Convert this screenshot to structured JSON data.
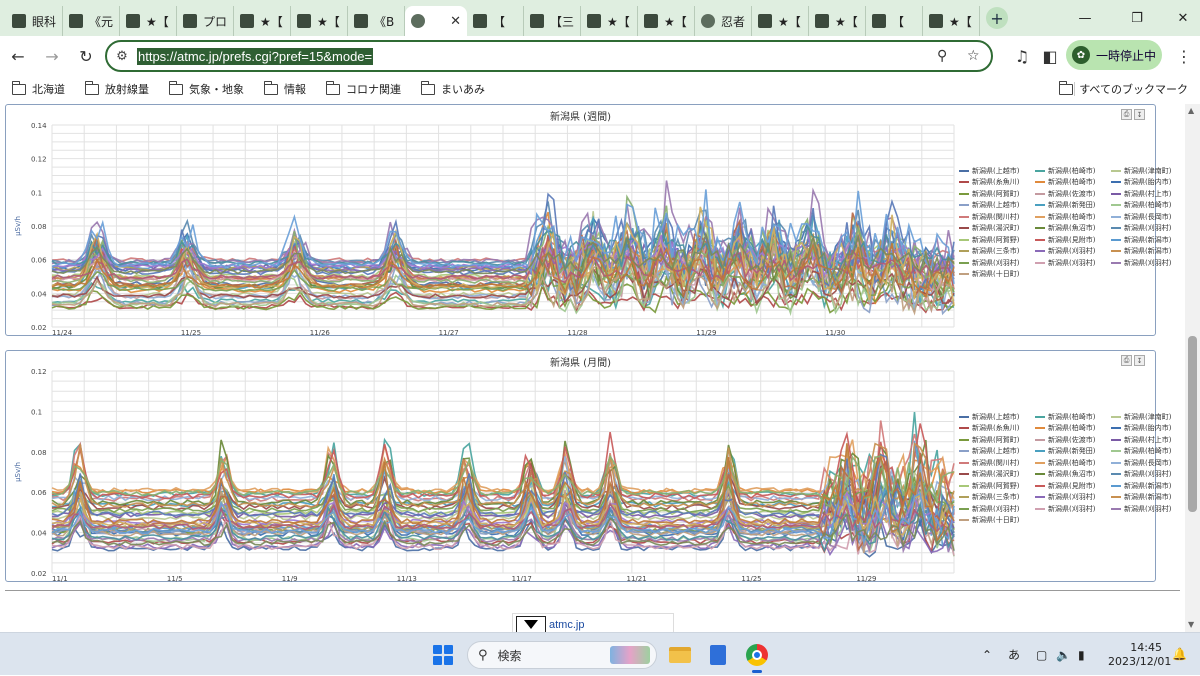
{
  "browser": {
    "tabs": [
      {
        "title": "眼科",
        "favicon": "site-icon"
      },
      {
        "title": "《元",
        "favicon": "site-icon"
      },
      {
        "title": "★【",
        "favicon": "site-icon"
      },
      {
        "title": "プロ",
        "favicon": "info-icon"
      },
      {
        "title": "★【",
        "favicon": "site-icon"
      },
      {
        "title": "★【",
        "favicon": "site-icon"
      },
      {
        "title": "《B",
        "favicon": "site-icon"
      },
      {
        "title": "",
        "favicon": "globe-icon",
        "active": true
      },
      {
        "title": "【",
        "favicon": "site-icon"
      },
      {
        "title": "【三",
        "favicon": "site-icon"
      },
      {
        "title": "★【",
        "favicon": "site-icon"
      },
      {
        "title": "★【",
        "favicon": "site-icon"
      },
      {
        "title": "忍者",
        "favicon": "globe-icon"
      },
      {
        "title": "★【",
        "favicon": "site-icon"
      },
      {
        "title": "★【",
        "favicon": "site-icon"
      },
      {
        "title": "【",
        "favicon": "site-icon"
      },
      {
        "title": "★【",
        "favicon": "site-icon"
      }
    ],
    "url": "https://atmc.jp/prefs.cgi?pref=15&mode=",
    "pause_label": "一時停止中",
    "bookmarks": [
      "北海道",
      "放射線量",
      "気象・地象",
      "情報",
      "コロナ関連",
      "まいあみ"
    ],
    "all_bookmarks_label": "すべてのブックマーク"
  },
  "charts": [
    {
      "title": "新潟県 (週間)",
      "ylabel": "μSv/h",
      "yticks": [
        "0.14",
        "0.12",
        "0.1",
        "0.08",
        "0.06",
        "0.04",
        "0.02"
      ],
      "xticks": [
        "11/24",
        "11/25",
        "11/26",
        "11/27",
        "11/28",
        "11/29",
        "11/30"
      ]
    },
    {
      "title": "新潟県 (月間)",
      "ylabel": "μSv/h",
      "yticks": [
        "0.12",
        "0.1",
        "0.08",
        "0.06",
        "0.04",
        "0.02"
      ],
      "xticks": [
        "11/1",
        "11/5",
        "11/9",
        "11/13",
        "11/17",
        "11/21",
        "11/25",
        "11/29"
      ]
    }
  ],
  "chart_data": [
    {
      "type": "line",
      "title": "新潟県 (週間)",
      "ylabel": "μSv/h",
      "ylim": [
        0.02,
        0.14
      ],
      "grid": true,
      "legend_position": "right",
      "x": [
        "11/24",
        "11/25",
        "11/26",
        "11/27",
        "11/28",
        "11/29",
        "11/30"
      ],
      "series_count": 38,
      "typical_range": [
        0.028,
        0.12
      ]
    },
    {
      "type": "line",
      "title": "新潟県 (月間)",
      "ylabel": "μSv/h",
      "ylim": [
        0.02,
        0.12
      ],
      "grid": true,
      "legend_position": "right",
      "x": [
        "11/1",
        "11/5",
        "11/9",
        "11/13",
        "11/17",
        "11/21",
        "11/25",
        "11/29"
      ],
      "series_count": 38,
      "typical_range": [
        0.027,
        0.102
      ]
    }
  ],
  "legend": [
    {
      "label": "新潟県(上越市)",
      "color": "#4a6fa5"
    },
    {
      "label": "新潟県(柏崎市)",
      "color": "#4aa5a0"
    },
    {
      "label": "新潟県(津南町)",
      "color": "#b8c890"
    },
    {
      "label": "新潟県(糸魚川)",
      "color": "#b04a4a"
    },
    {
      "label": "新潟県(柏崎市)",
      "color": "#e08a3c"
    },
    {
      "label": "新潟県(胎内市)",
      "color": "#3c6fb0"
    },
    {
      "label": "新潟県(阿賀町)",
      "color": "#7a9a3c"
    },
    {
      "label": "新潟県(佐渡市)",
      "color": "#c49aa0"
    },
    {
      "label": "新潟県(村上市)",
      "color": "#7a5aa5"
    },
    {
      "label": "新潟県(上越市)",
      "color": "#8aa0c8"
    },
    {
      "label": "新潟県(新発田)",
      "color": "#4aa0c0"
    },
    {
      "label": "新潟県(柏崎市)",
      "color": "#a0c890"
    },
    {
      "label": "新潟県(関川村)",
      "color": "#d07a7a"
    },
    {
      "label": "新潟県(柏崎市)",
      "color": "#e0a060"
    },
    {
      "label": "新潟県(長岡市)",
      "color": "#90b0d8"
    },
    {
      "label": "新潟県(湯沢町)",
      "color": "#9a4a4a"
    },
    {
      "label": "新潟県(魚沼市)",
      "color": "#6a8a3a"
    },
    {
      "label": "新潟県(刈羽村)",
      "color": "#5a8ab0"
    },
    {
      "label": "新潟県(阿賀野)",
      "color": "#a8c878"
    },
    {
      "label": "新潟県(見附市)",
      "color": "#c85a5a"
    },
    {
      "label": "新潟県(新潟市)",
      "color": "#5a9ad0"
    },
    {
      "label": "新潟県(三条市)",
      "color": "#b0a05a"
    },
    {
      "label": "新潟県(刈羽村)",
      "color": "#8a6ab8"
    },
    {
      "label": "新潟県(新潟市)",
      "color": "#c89050"
    },
    {
      "label": "新潟県(刈羽村)",
      "color": "#7aa050"
    },
    {
      "label": "新潟県(刈羽村)",
      "color": "#d0a0b0"
    },
    {
      "label": "新潟県(刈羽村)",
      "color": "#9a7ab0"
    },
    {
      "label": "新潟県(十日町)",
      "color": "#c0a080"
    }
  ],
  "footer": {
    "site": "atmc.jp"
  },
  "taskbar": {
    "search_placeholder": "検索",
    "ime": "あ",
    "time": "14:45",
    "date": "2023/12/01"
  }
}
